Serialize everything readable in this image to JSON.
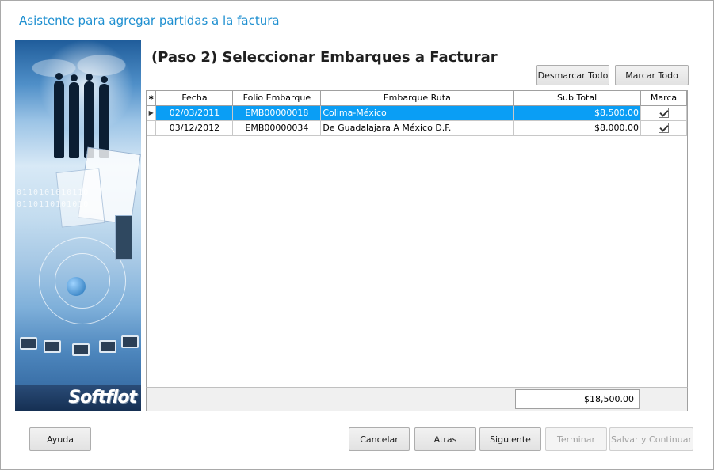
{
  "window": {
    "title": "Asistente para agregar partidas a la factura"
  },
  "sidebar": {
    "logo_text": "Softflot",
    "binary_lines": [
      "0110101010110",
      "0110110101010"
    ]
  },
  "step": {
    "title": "(Paso 2) Seleccionar Embarques a Facturar"
  },
  "toolbar": {
    "unmark_all_label": "Desmarcar Todo",
    "mark_all_label": "Marcar Todo"
  },
  "grid": {
    "columns": [
      "",
      "Fecha",
      "Folio Embarque",
      "Embarque Ruta",
      "Sub Total",
      "Marca"
    ],
    "new_row_glyph": "✱",
    "current_row_glyph": "▶",
    "rows": [
      {
        "fecha": "02/03/2011",
        "folio": "EMB00000018",
        "ruta": "Colima-México",
        "subtotal": "$8,500.00",
        "marca": true,
        "selected": true
      },
      {
        "fecha": "03/12/2012",
        "folio": "EMB00000034",
        "ruta": "De Guadalajara A México D.F.",
        "subtotal": "$8,000.00",
        "marca": true,
        "selected": false
      }
    ],
    "total": "$18,500.00"
  },
  "footer": {
    "help_label": "Ayuda",
    "cancel_label": "Cancelar",
    "back_label": "Atras",
    "next_label": "Siguiente",
    "finish_label": "Terminar",
    "save_continue_label": "Salvar y Continuar"
  },
  "colors": {
    "title": "#1e8fd0",
    "selection": "#0a9ef5"
  }
}
